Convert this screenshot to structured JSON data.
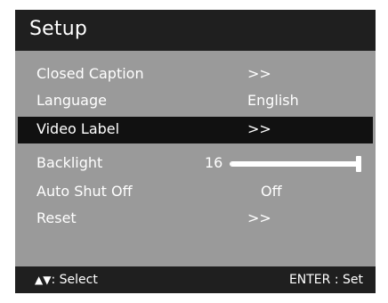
{
  "header": {
    "title": "Setup"
  },
  "menu": {
    "items": [
      {
        "label": "Closed Caption",
        "value": ">>"
      },
      {
        "label": "Language",
        "value": "English"
      },
      {
        "label": "Video Label",
        "value": ">>",
        "selected": true
      },
      {
        "label": "Backlight",
        "value": "16",
        "slider_level": 1.0
      },
      {
        "label": "Auto Shut Off",
        "value": "Off"
      },
      {
        "label": "Reset",
        "value": ">>"
      }
    ]
  },
  "footer": {
    "nav_arrows": "▲▼",
    "nav_label": ": Select",
    "enter_label": "ENTER : Set"
  },
  "colors": {
    "header_bg": "#1f1f1f",
    "menu_bg": "#9a9a9a",
    "selected_bg": "#111111",
    "text": "#ffffff"
  }
}
